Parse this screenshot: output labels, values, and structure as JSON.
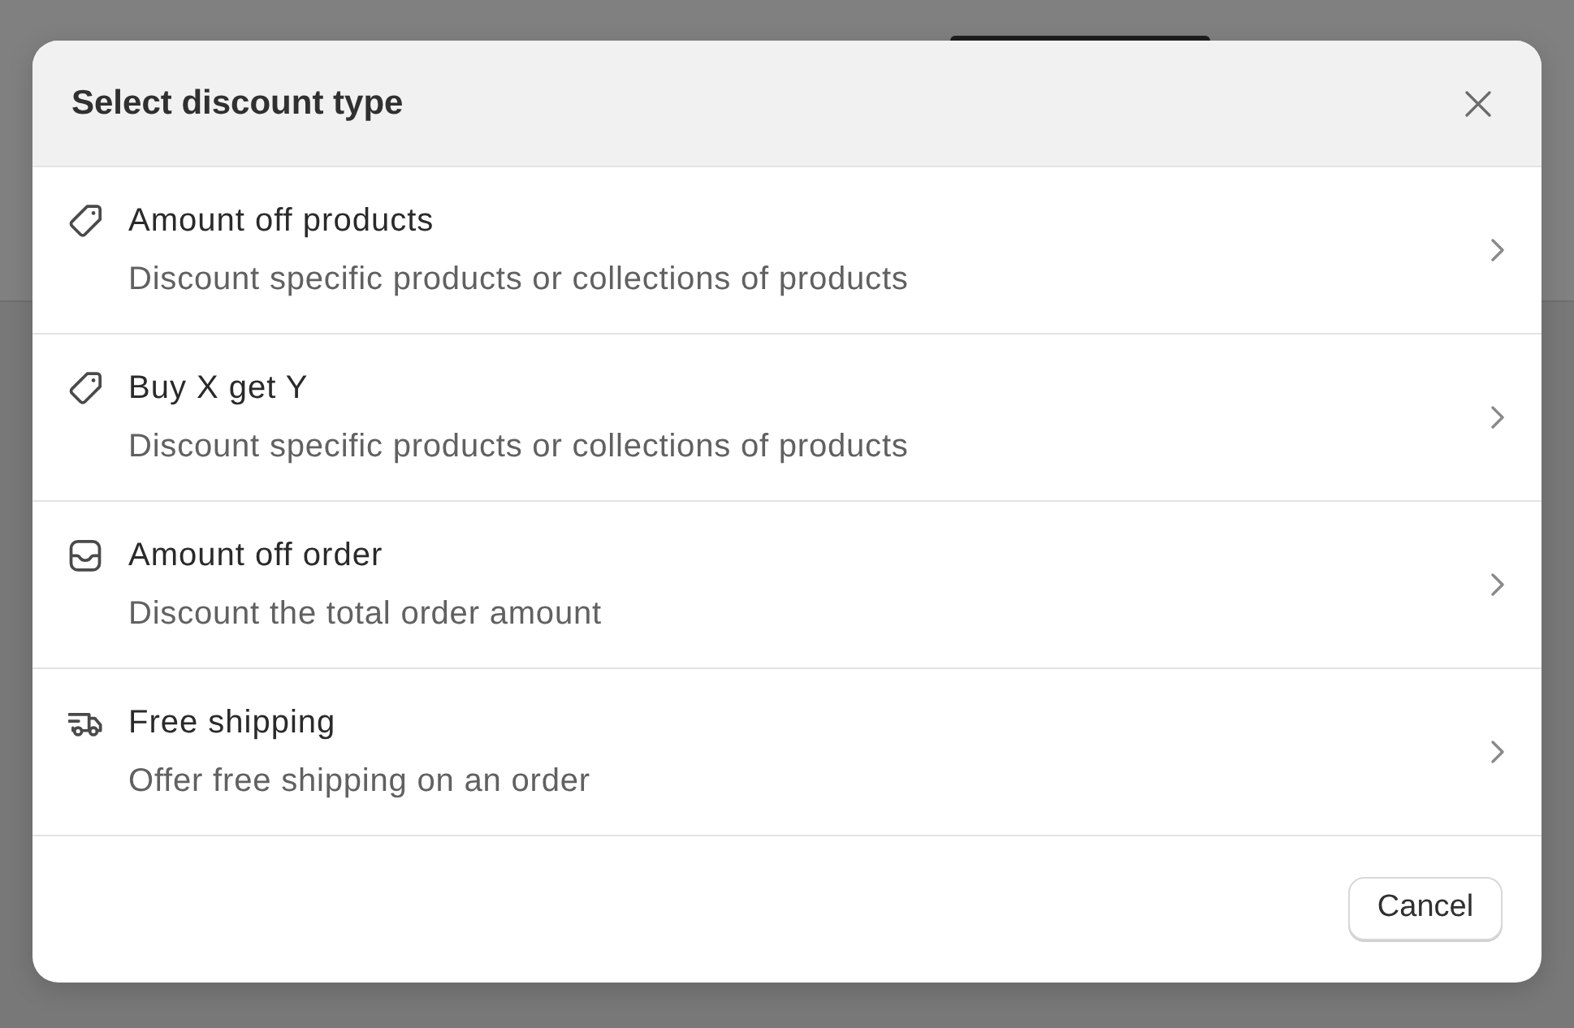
{
  "dialog": {
    "title": "Select discount type"
  },
  "options": [
    {
      "kind": "tag",
      "title": "Amount off products",
      "description": "Discount specific products or collections of products"
    },
    {
      "kind": "tag",
      "title": "Buy X get Y",
      "description": "Discount specific products or collections of products"
    },
    {
      "kind": "tray",
      "title": "Amount off order",
      "description": "Discount the total order amount"
    },
    {
      "kind": "truck",
      "title": "Free shipping",
      "description": "Offer free shipping on an order"
    }
  ],
  "footer": {
    "cancel_button": "Cancel"
  }
}
